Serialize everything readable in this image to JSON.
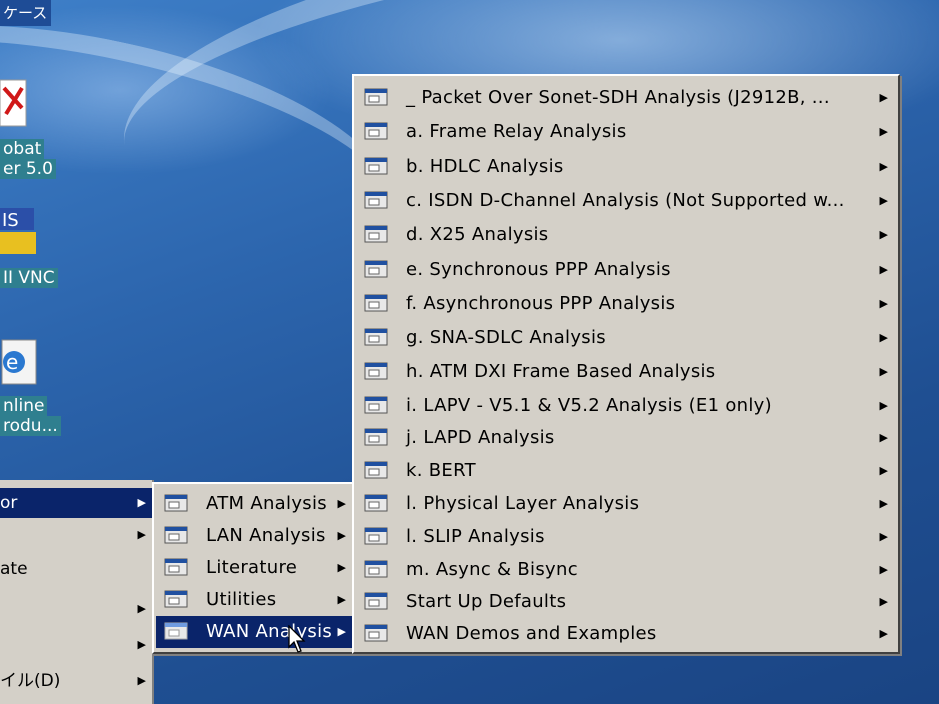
{
  "desktop": {
    "taskbar_tab": "ケース",
    "icons": [
      {
        "name": "acrobat",
        "lines": [
          "obat",
          "er 5.0"
        ]
      },
      {
        "name": "vnc",
        "lines": [
          "II VNC"
        ]
      },
      {
        "name": "online",
        "lines": [
          "nline",
          "rodu..."
        ]
      }
    ]
  },
  "start_panel": {
    "items": [
      {
        "label": "or",
        "arrow": "▶",
        "selected": true
      },
      {
        "label": "",
        "arrow": "▶",
        "selected": false
      },
      {
        "label": "ate",
        "arrow": "",
        "selected": false
      },
      {
        "label": "",
        "arrow": "▶",
        "selected": false
      },
      {
        "label": "",
        "arrow": "▶",
        "selected": false
      },
      {
        "label": "イル(D)",
        "arrow": "▶",
        "selected": false
      }
    ]
  },
  "submenu": {
    "items": [
      {
        "label": "ATM Analysis",
        "arrow": "▶"
      },
      {
        "label": "LAN Analysis",
        "arrow": "▶"
      },
      {
        "label": "Literature",
        "arrow": "▶"
      },
      {
        "label": "Utilities",
        "arrow": "▶"
      },
      {
        "label": "WAN Analysis",
        "arrow": "▶",
        "selected": true
      }
    ]
  },
  "wan_menu": {
    "items": [
      {
        "label": "_  Packet Over Sonet-SDH Analysis (J2912B, ...",
        "arrow": "▶"
      },
      {
        "label": "a.  Frame Relay Analysis",
        "arrow": "▶"
      },
      {
        "label": "b.  HDLC Analysis",
        "arrow": "▶"
      },
      {
        "label": "c.  ISDN D-Channel Analysis (Not Supported w...",
        "arrow": "▶"
      },
      {
        "label": "d.  X25 Analysis",
        "arrow": "▶"
      },
      {
        "label": "e.  Synchronous PPP Analysis",
        "arrow": "▶"
      },
      {
        "label": "f.  Asynchronous PPP Analysis",
        "arrow": "▶"
      },
      {
        "label": "g.  SNA-SDLC Analysis",
        "arrow": "▶"
      },
      {
        "label": "h.  ATM DXI Frame Based Analysis",
        "arrow": "▶"
      },
      {
        "label": "i.  LAPV - V5.1 & V5.2 Analysis (E1 only)",
        "arrow": "▶"
      },
      {
        "label": "j.  LAPD Analysis",
        "arrow": "▶"
      },
      {
        "label": "k.  BERT",
        "arrow": "▶"
      },
      {
        "label": "l.  Physical Layer Analysis",
        "arrow": "▶"
      },
      {
        "label": "l.  SLIP Analysis",
        "arrow": "▶"
      },
      {
        "label": "m.  Async & Bisync",
        "arrow": "▶"
      },
      {
        "label": "Start Up Defaults",
        "arrow": "▶"
      },
      {
        "label": "WAN Demos and Examples",
        "arrow": "▶"
      }
    ]
  },
  "colors": {
    "menu_bg": "#d4d0c8",
    "selection": "#0a246a",
    "desktop": "#2c65ad"
  }
}
